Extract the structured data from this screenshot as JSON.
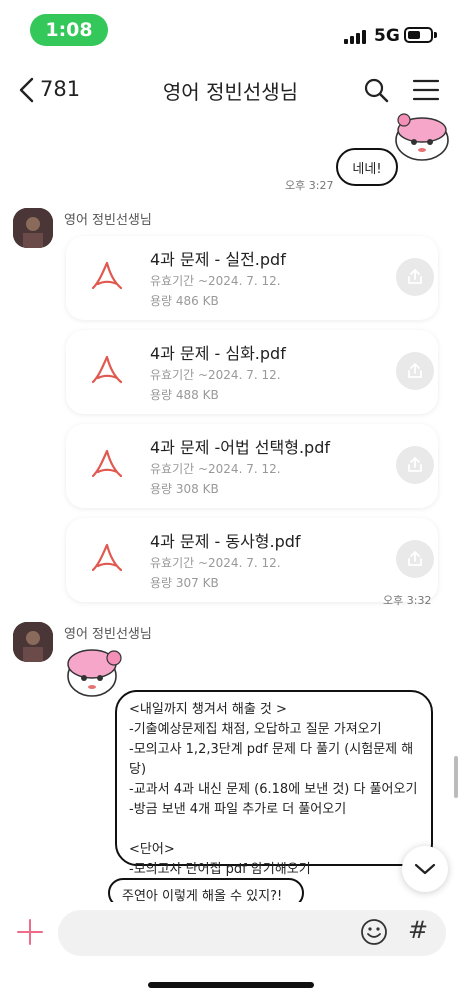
{
  "status_bar": {
    "time": "1:08",
    "network": "5G"
  },
  "header": {
    "back_count": "781",
    "title": "영어 정빈선생님"
  },
  "messages": {
    "my_reply": {
      "text": "네네!",
      "time": "오후 3:27"
    },
    "file_group": {
      "sender": "영어 정빈선생님",
      "time": "오후 3:32",
      "files": [
        {
          "name": "4과 문제 - 실전.pdf",
          "expiry": "유효기간 ~2024. 7. 12.",
          "size": "용량 486 KB"
        },
        {
          "name": "4과 문제 - 심화.pdf",
          "expiry": "유효기간 ~2024. 7. 12.",
          "size": "용량 488 KB"
        },
        {
          "name": "4과 문제 -어법 선택형.pdf",
          "expiry": "유효기간 ~2024. 7. 12.",
          "size": "용량 308 KB"
        },
        {
          "name": "4과 문제 - 동사형.pdf",
          "expiry": "유효기간 ~2024. 7. 12.",
          "size": "용량 307 KB"
        }
      ]
    },
    "notice": {
      "sender": "영어 정빈선생님",
      "lines": [
        "<내일까지 챙겨서 해출 것 >",
        "-기출예상문제집 채점, 오답하고 질문 가져오기",
        "-모의고사 1,2,3단계 pdf 문제 다 풀기 (시험문제 해",
        "당)",
        "-교과서 4과 내신 문제 (6.18에 보낸 것) 다 풀어오기",
        "-방금 보낸 4개 파일 추가로 더 풀어오기",
        "",
        "<단어>",
        "-모의고사 단어집 pdf 암기해오기"
      ]
    },
    "last_message": {
      "text": "주연아 이렇게 해올 수 있지?!"
    }
  },
  "colors": {
    "status_pill": "#34c759",
    "pdf_red": "#e0584f",
    "plus_pink": "#f06a8a"
  },
  "icons": [
    "back-icon",
    "search-icon",
    "menu-icon",
    "pdf-icon",
    "share-icon",
    "chevron-down-icon",
    "plus-icon",
    "emoji-icon",
    "hash-icon"
  ]
}
